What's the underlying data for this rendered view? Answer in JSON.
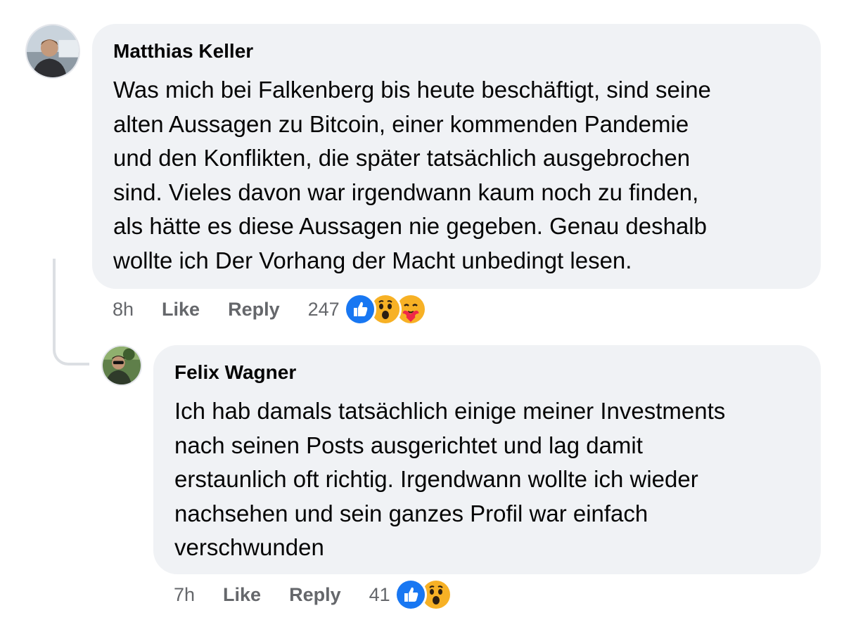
{
  "comments": [
    {
      "author": "Matthias Keller",
      "text": "Was mich bei Falkenberg bis heute beschäftigt, sind seine\nalten Aussagen zu Bitcoin, einer kommenden Pandemie\nund den Konflikten, die später tatsächlich ausgebrochen\nsind. Vieles davon war irgendwann kaum noch zu finden,\nals hätte es diese Aussagen nie gegeben. Genau deshalb\nwollte ich Der Vorhang der Macht unbedingt lesen.",
      "time": "8h",
      "like_label": "Like",
      "reply_label": "Reply",
      "reaction_count": "247",
      "reactions": [
        "like-icon",
        "wow-icon",
        "care-icon"
      ]
    },
    {
      "author": "Felix Wagner",
      "text": "Ich hab damals tatsächlich einige meiner Investments\nnach seinen Posts ausgerichtet und lag damit\nerstaunlich oft richtig. Irgendwann wollte ich wieder\nnachsehen und sein ganzes Profil war einfach\nverschwunden",
      "time": "7h",
      "like_label": "Like",
      "reply_label": "Reply",
      "reaction_count": "41",
      "reactions": [
        "like-icon",
        "wow-icon"
      ]
    }
  ],
  "colors": {
    "bubble": "#f0f2f5",
    "meta_text": "#65676b",
    "like_blue": "#1877f2",
    "wow_yellow": "#f7b125"
  }
}
